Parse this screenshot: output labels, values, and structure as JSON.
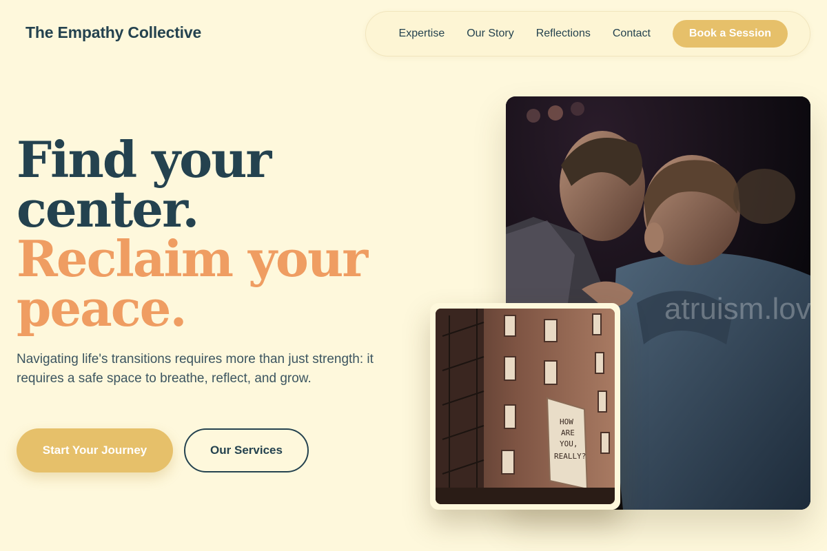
{
  "header": {
    "brand": "The Empathy Collective",
    "nav": [
      {
        "label": "Expertise"
      },
      {
        "label": "Our Story"
      },
      {
        "label": "Reflections"
      },
      {
        "label": "Contact"
      }
    ],
    "cta_label": "Book a Session"
  },
  "hero": {
    "headline_line1": "Find your",
    "headline_line2": "center.",
    "headline_line3": "Reclaim your",
    "headline_line4": "peace.",
    "subtext": "Navigating life's transitions requires more than just strength: it requires a safe space to breathe, reflect, and grow.",
    "primary_button": "Start Your Journey",
    "secondary_button": "Our Services"
  },
  "images": {
    "main_watermark": "unsplash-style watermark",
    "main_watermark_text": "atruism.love",
    "small_sign_text": [
      "HOW",
      "ARE",
      "YOU,",
      "REALLY?"
    ]
  },
  "colors": {
    "background": "#fef8dc",
    "navy": "#24424f",
    "accent_orange": "#ef9d62",
    "accent_gold": "#e6c06a"
  }
}
